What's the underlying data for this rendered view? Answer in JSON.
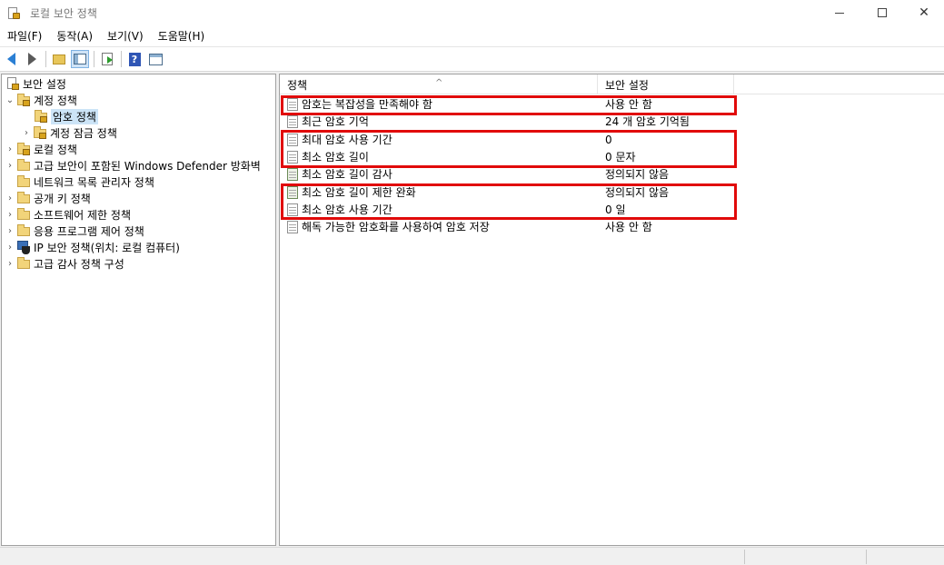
{
  "window": {
    "title": "로컬 보안 정책"
  },
  "menu": [
    "파일(F)",
    "동작(A)",
    "보기(V)",
    "도움말(H)"
  ],
  "toolbar": {
    "buttons": [
      "back-icon",
      "forward-icon",
      "up-folder-icon",
      "show-hide-tree-icon",
      "export-list-icon",
      "help-icon",
      "properties-icon"
    ]
  },
  "tree": {
    "items": [
      {
        "label": "보안 설정",
        "icon": "security-settings-icon"
      },
      {
        "label": "계정 정책",
        "icon": "folder-lock-icon",
        "expanded": true
      },
      {
        "label": "암호 정책",
        "icon": "folder-lock-icon",
        "selected": true
      },
      {
        "label": "계정 잠금 정책",
        "icon": "folder-lock-icon"
      },
      {
        "label": "로컬 정책",
        "icon": "folder-lock-icon"
      },
      {
        "label": "고급 보안이 포함된 Windows Defender 방화벽",
        "icon": "folder-icon"
      },
      {
        "label": "네트워크 목록 관리자 정책",
        "icon": "folder-icon"
      },
      {
        "label": "공개 키 정책",
        "icon": "folder-icon"
      },
      {
        "label": "소프트웨어 제한 정책",
        "icon": "folder-icon"
      },
      {
        "label": "응용 프로그램 제어 정책",
        "icon": "folder-icon"
      },
      {
        "label": "IP 보안 정책(위치: 로컬 컴퓨터)",
        "icon": "ip-security-icon"
      },
      {
        "label": "고급 감사 정책 구성",
        "icon": "folder-icon"
      }
    ]
  },
  "list": {
    "columns": [
      "정책",
      "보안 설정"
    ],
    "sort_indicator": "^",
    "rows": [
      {
        "policy": "암호는 복잡성을 만족해야 함",
        "setting": "사용 안 함",
        "icon": "policy-icon",
        "highlighted": true
      },
      {
        "policy": "최근 암호 기억",
        "setting": "24 개 암호 기억됨",
        "icon": "policy-icon",
        "highlighted": false
      },
      {
        "policy": "최대 암호 사용 기간",
        "setting": "0",
        "icon": "policy-icon",
        "highlighted": true
      },
      {
        "policy": "최소 암호 길이",
        "setting": "0 문자",
        "icon": "policy-icon",
        "highlighted": true
      },
      {
        "policy": "최소 암호 길이 감사",
        "setting": "정의되지 않음",
        "icon": "audit-policy-icon",
        "highlighted": false
      },
      {
        "policy": "최소 암호 길이 제한 완화",
        "setting": "정의되지 않음",
        "icon": "audit-policy-icon",
        "highlighted": true
      },
      {
        "policy": "최소 암호 사용 기간",
        "setting": "0 일",
        "icon": "policy-icon",
        "highlighted": true
      },
      {
        "policy": "해독 가능한 암호화를 사용하여 암호 저장",
        "setting": "사용 안 함",
        "icon": "policy-icon",
        "highlighted": false
      }
    ]
  },
  "colors": {
    "highlight_border": "#e10a0a",
    "selection": "#cce4f7"
  }
}
